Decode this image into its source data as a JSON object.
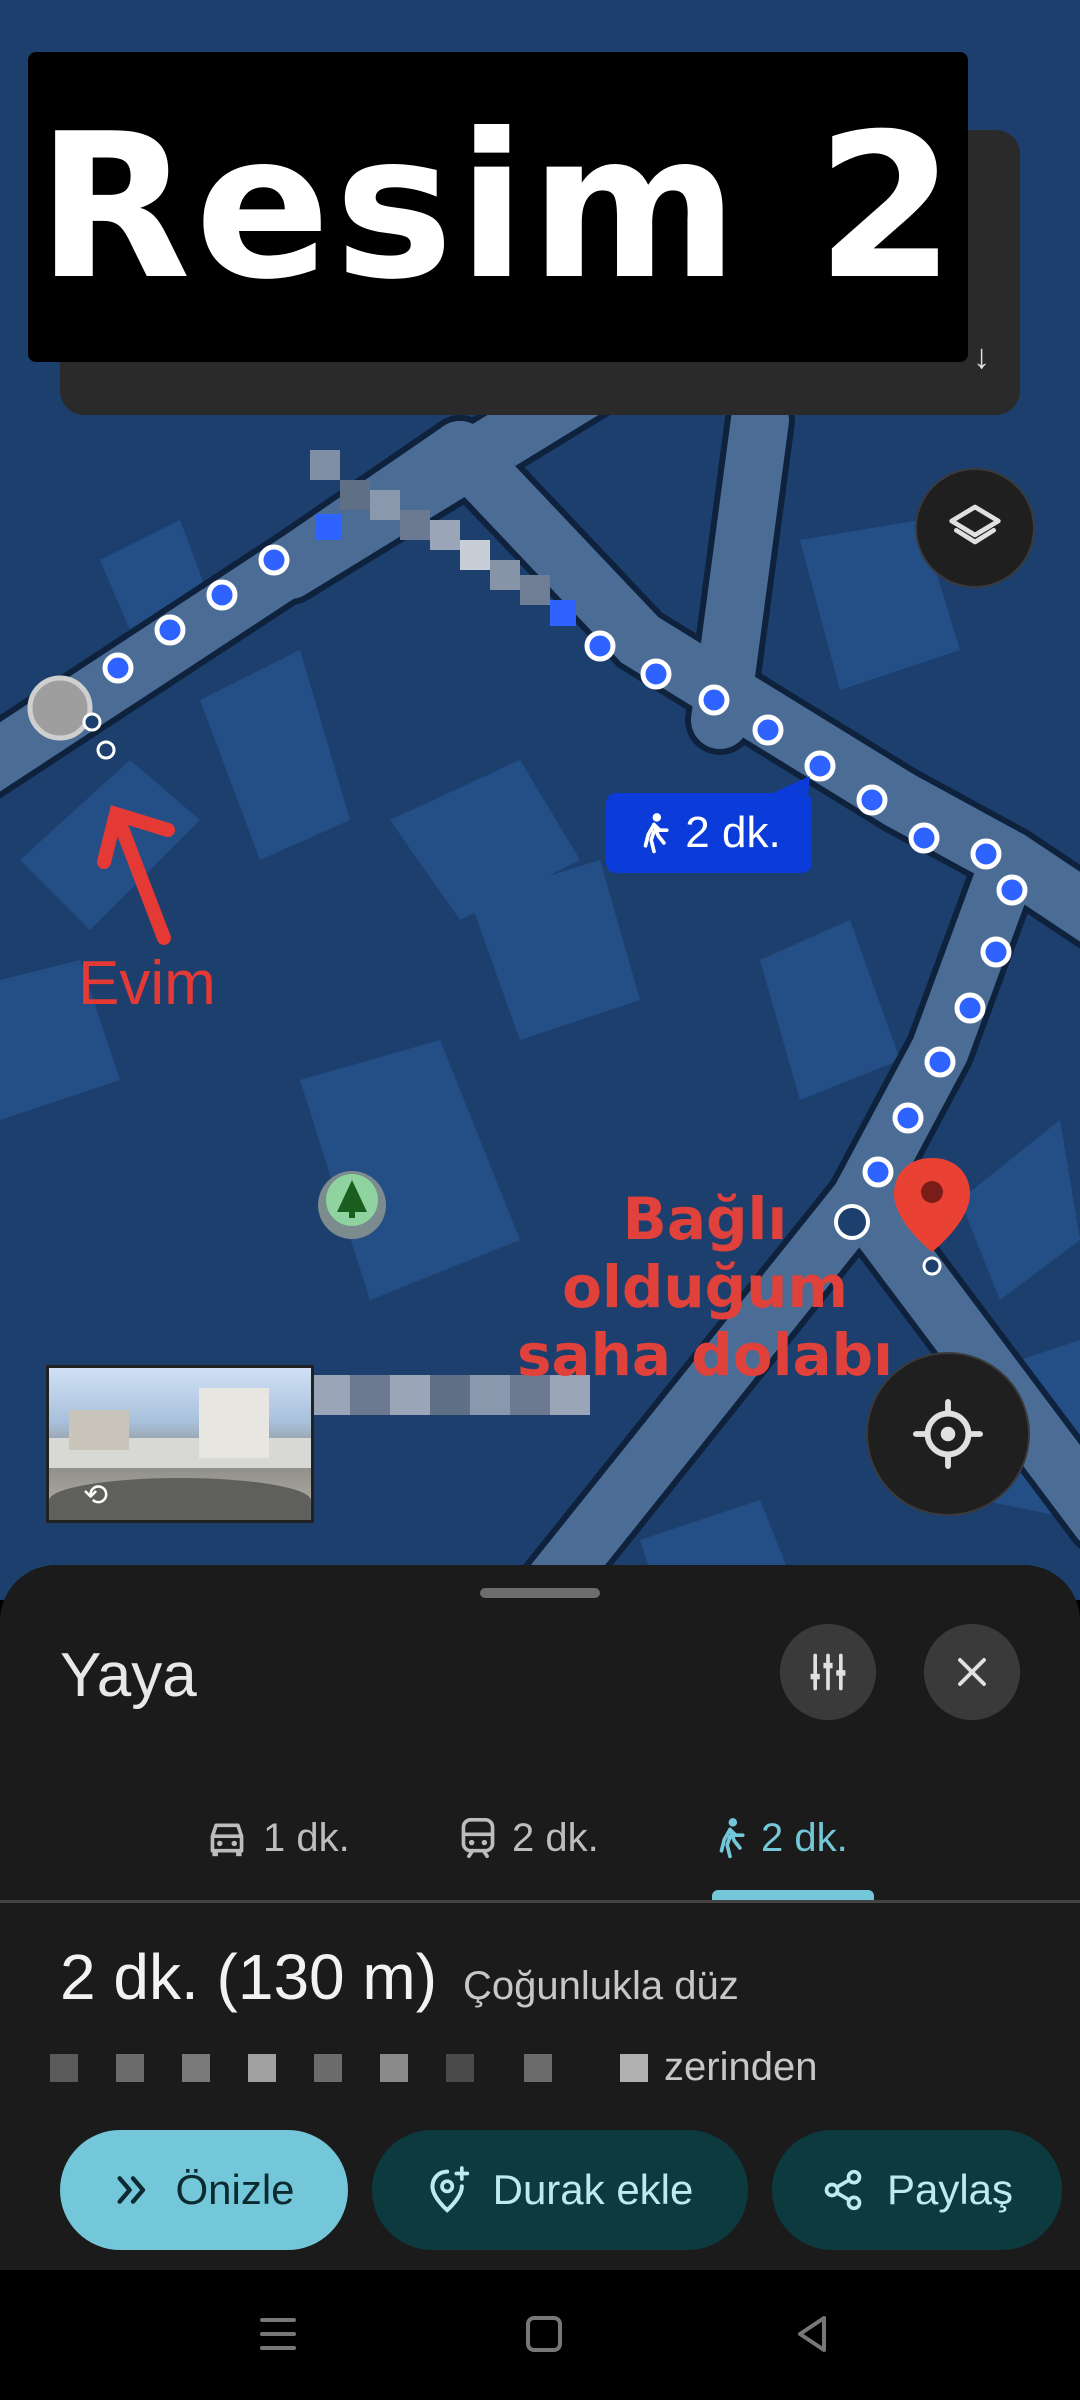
{
  "overlay": {
    "title": "Resim 2"
  },
  "map": {
    "walk_chip_label": "2 dk.",
    "annotation_home": "Evim",
    "annotation_cabinet_line1": "Bağlı olduğum",
    "annotation_cabinet_line2": "saha dolabı",
    "icons": {
      "layers": "layers-icon",
      "location": "my-location-icon",
      "destination": "destination-pin-icon",
      "park": "park-tree-icon",
      "walk": "walk-icon"
    }
  },
  "sheet": {
    "mode_title": "Yaya",
    "tabs": [
      {
        "icon": "car-icon",
        "label": "1 dk."
      },
      {
        "icon": "transit-icon",
        "label": "2 dk."
      },
      {
        "icon": "walk-icon",
        "label": "2 dk.",
        "active": true
      }
    ],
    "summary_duration": "2 dk. (130 m)",
    "summary_note": "Çoğunlukla düz",
    "via_suffix": "zerinden",
    "buttons": {
      "preview": "Önizle",
      "add_stop": "Durak ekle",
      "share": "Paylaş"
    }
  },
  "colors": {
    "map_background": "#1c3f6e",
    "road": "#4b6c95",
    "route_dot": "#2e63ff",
    "accent": "#73c7d9",
    "pin_red": "#e94235"
  }
}
